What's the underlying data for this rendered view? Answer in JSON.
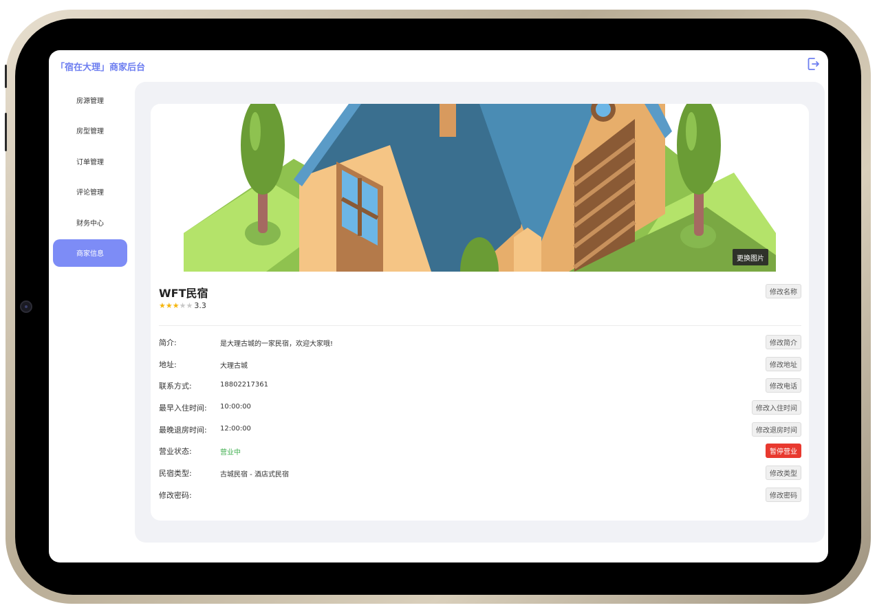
{
  "app": {
    "brand": "「宿在大理」商家后台",
    "accent_color": "#7d8cf6",
    "logout_icon": "logout-icon"
  },
  "sidebar": {
    "items": [
      {
        "label": "房源管理",
        "active": false
      },
      {
        "label": "房型管理",
        "active": false
      },
      {
        "label": "订单管理",
        "active": false
      },
      {
        "label": "评论管理",
        "active": false
      },
      {
        "label": "财务中心",
        "active": false
      },
      {
        "label": "商家信息",
        "active": true
      }
    ]
  },
  "shop": {
    "change_image_label": "更换图片",
    "name": "WFT民宿",
    "rating": 3.3,
    "rating_text": "3.3",
    "stars_filled": 3,
    "stars_total": 5,
    "edit_name_label": "修改名称"
  },
  "details": [
    {
      "label": "简介:",
      "value": "是大理古城的一家民宿，欢迎大家哦!",
      "button": "修改简介",
      "danger": false
    },
    {
      "label": "地址:",
      "value": "大理古城",
      "button": "修改地址",
      "danger": false
    },
    {
      "label": "联系方式:",
      "value": "18802217361",
      "button": "修改电话",
      "danger": false
    },
    {
      "label": "最早入住时间:",
      "value": "10:00:00",
      "button": "修改入住时间",
      "danger": false
    },
    {
      "label": "最晚退房时间:",
      "value": "12:00:00",
      "button": "修改退房时间",
      "danger": false
    },
    {
      "label": "营业状态:",
      "value": "营业中",
      "button": "暂停营业",
      "danger": true,
      "value_color": "#3fae4e"
    },
    {
      "label": "民宿类型:",
      "value": "古城民宿 - 酒店式民宿",
      "button": "修改类型",
      "danger": false
    },
    {
      "label": "修改密码:",
      "value": "",
      "button": "修改密码",
      "danger": false
    }
  ]
}
